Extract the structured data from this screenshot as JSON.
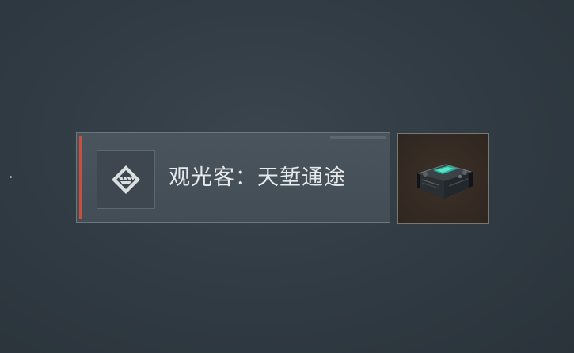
{
  "notification": {
    "title": "观光客：天堑通途",
    "accent_color": "#c8503e",
    "badge_icon": "diamond-emblem-icon",
    "reward_item_icon": "device-box-icon"
  }
}
